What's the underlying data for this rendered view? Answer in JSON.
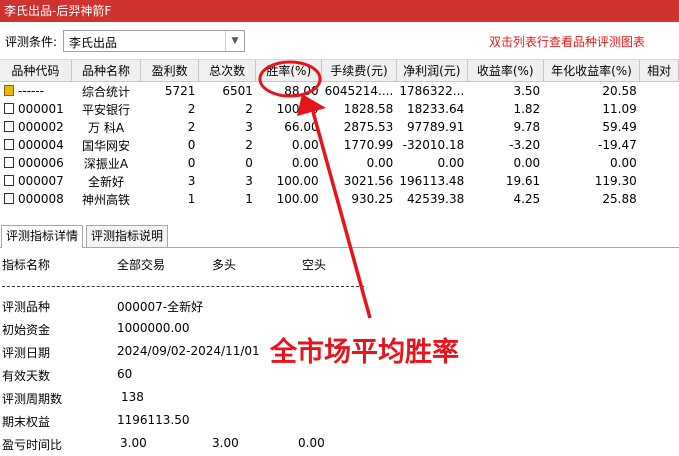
{
  "window": {
    "title": "李氏出品-后羿神箭F"
  },
  "toolbar": {
    "condition_label": "评测条件:",
    "condition_value": "李氏出品",
    "hint": "双击列表行查看品种评测图表"
  },
  "table": {
    "columns": [
      "品种代码",
      "品种名称",
      "盈利数",
      "总次数",
      "胜率(%)",
      "手续费(元)",
      "净利润(元)",
      "收益率(%)",
      "年化收益率(%)",
      "相对"
    ],
    "rows": [
      [
        "------",
        "综合统计",
        "5721",
        "6501",
        "88.00",
        "6045214....",
        "1786322...",
        "3.50",
        "20.58",
        ""
      ],
      [
        "000001",
        "平安银行",
        "2",
        "2",
        "100.00",
        "1828.58",
        "18233.64",
        "1.82",
        "11.09",
        ""
      ],
      [
        "000002",
        "万 科A",
        "2",
        "3",
        "66.00",
        "2875.53",
        "97789.91",
        "9.78",
        "59.49",
        ""
      ],
      [
        "000004",
        "国华网安",
        "0",
        "2",
        "0.00",
        "1770.99",
        "-32010.18",
        "-3.20",
        "-19.47",
        ""
      ],
      [
        "000006",
        "深振业A",
        "0",
        "0",
        "0.00",
        "0.00",
        "0.00",
        "0.00",
        "0.00",
        ""
      ],
      [
        "000007",
        "全新好",
        "3",
        "3",
        "100.00",
        "3021.56",
        "196113.48",
        "19.61",
        "119.30",
        ""
      ],
      [
        "000008",
        "神州高铁",
        "1",
        "1",
        "100.00",
        "930.25",
        "42539.38",
        "4.25",
        "25.88",
        ""
      ],
      [
        "",
        "",
        "",
        "",
        "",
        "",
        "",
        "",
        "",
        ""
      ]
    ]
  },
  "tabs": [
    {
      "label": "评测指标详情"
    },
    {
      "label": "评测指标说明"
    }
  ],
  "details": {
    "header": {
      "name": "指标名称",
      "all": "全部交易",
      "long": "多头",
      "short": "空头"
    },
    "rows": [
      {
        "label": "评测品种",
        "values": [
          "000007-全新好"
        ]
      },
      {
        "label": "初始资金",
        "values": [
          "1000000.00"
        ]
      },
      {
        "label": "评测日期",
        "values": [
          "2024/09/02-2024/11/01"
        ]
      },
      {
        "label": "有效天数",
        "values": [
          "60"
        ]
      },
      {
        "label": "评测周期数",
        "values": [
          "138"
        ]
      },
      {
        "label": "期末权益",
        "values": [
          "1196113.50"
        ]
      },
      {
        "label": "盈亏时间比",
        "values": [
          "3.00",
          "3.00",
          "0.00"
        ]
      }
    ]
  },
  "annotation": {
    "text": "全市场平均胜率",
    "color": "#e8141c"
  },
  "colors": {
    "titlebar": "#d0332f",
    "hint": "#e21b1b",
    "annotation": "#e8141c"
  }
}
